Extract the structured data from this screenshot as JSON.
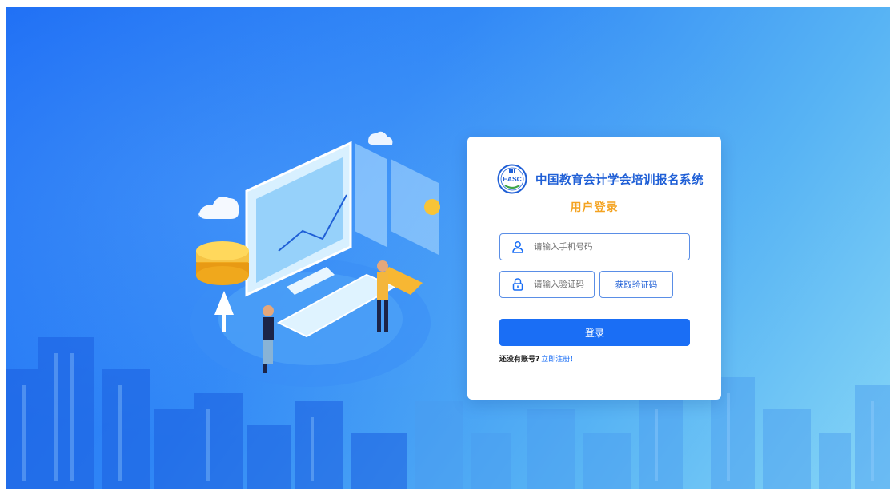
{
  "brand": {
    "logo_text": "EASC",
    "system_title": "中国教育会计学会培训报名系统",
    "subtitle": "用户登录"
  },
  "form": {
    "phone": {
      "placeholder": "请输入手机号码",
      "value": "",
      "icon": "user-icon"
    },
    "code": {
      "placeholder": "请输入验证码",
      "value": "",
      "icon": "lock-icon"
    },
    "get_code_label": "获取验证码",
    "login_label": "登录",
    "register_prompt": "还没有账号?",
    "register_link": "立即注册！"
  },
  "colors": {
    "accent": "#1a6ef5",
    "brand_title": "#1f5fd6",
    "subtitle": "#f4a321",
    "field_border": "#5a8ee6"
  }
}
